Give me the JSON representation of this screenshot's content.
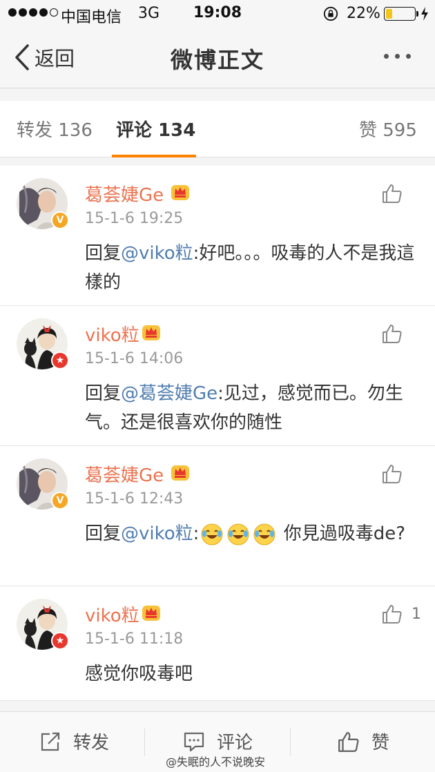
{
  "status_bar": {
    "carrier": "中国电信",
    "network": "3G",
    "time": "19:08",
    "battery_pct": "22%",
    "battery_level": 0.22
  },
  "nav": {
    "back_label": "返回",
    "title": "微博正文"
  },
  "tabs": [
    {
      "label": "转发 136"
    },
    {
      "label": "评论 134"
    },
    {
      "label": "赞 595"
    }
  ],
  "comments": [
    {
      "user": "葛荟婕Ge",
      "time": "15-1-6 19:25",
      "prefix": "回复",
      "mention": "@viko粒",
      "text": ":好吧。。。吸毒的人不是我這樣的",
      "likes": ""
    },
    {
      "user": "viko粒",
      "time": "15-1-6 14:06",
      "prefix": "回复",
      "mention": "@葛荟婕Ge",
      "text": ":见过，感觉而已。勿生气。还是很喜欢你的随性",
      "likes": ""
    },
    {
      "user": "葛荟婕Ge",
      "time": "15-1-6 12:43",
      "prefix": "回复",
      "mention": "@viko粒",
      "text_before": ":",
      "text_after": " 你見過吸毒de?",
      "likes": ""
    },
    {
      "user": "viko粒",
      "time": "15-1-6 11:18",
      "text": "感觉你吸毒吧",
      "likes": "1"
    }
  ],
  "toolbar": {
    "repost_label": "转发",
    "comment_label": "评论",
    "like_label": "赞"
  },
  "watermark": "@失眠的人不说晚安",
  "colors": {
    "accent": "#ff8200",
    "username": "#eb7350",
    "mention": "#507daf",
    "verified_badge": "#f5a623",
    "vip_badge": "#e8372d"
  }
}
